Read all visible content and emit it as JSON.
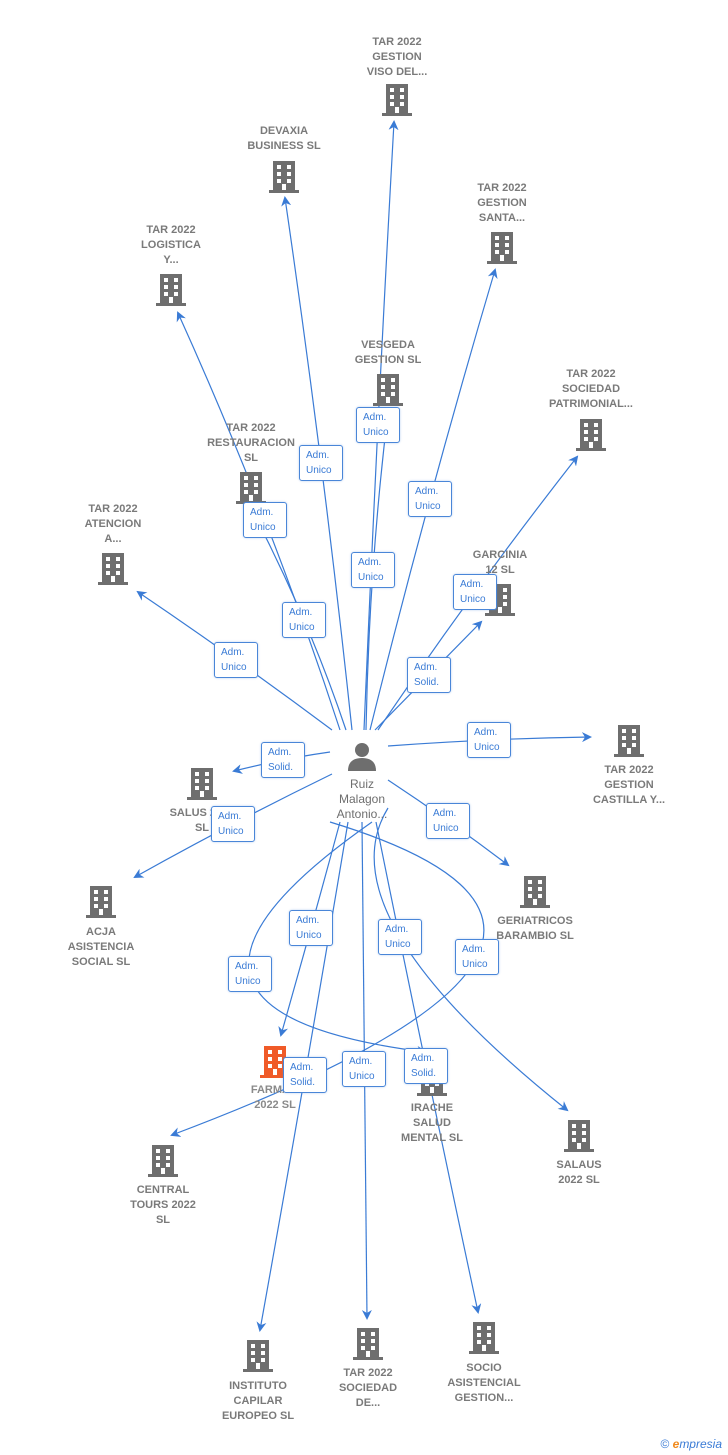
{
  "center": {
    "label_lines": [
      "Ruiz",
      "Malagon",
      "Antonio..."
    ],
    "icon": "person-icon"
  },
  "colors": {
    "edge": "#3a7bd5",
    "company": "#6e6e6e",
    "highlight": "#f05a28"
  },
  "companies": [
    {
      "lines": [
        "TAR 2022",
        "GESTION",
        "VISO DEL..."
      ]
    },
    {
      "lines": [
        "DEVAXIA",
        "BUSINESS  SL"
      ]
    },
    {
      "lines": [
        "TAR 2022",
        "GESTION",
        "SANTA..."
      ]
    },
    {
      "lines": [
        "TAR 2022",
        "LOGISTICA",
        "Y..."
      ]
    },
    {
      "lines": [
        "VESGEDA",
        "GESTION  SL"
      ]
    },
    {
      "lines": [
        "TAR 2022",
        "SOCIEDAD",
        "PATRIMONIAL..."
      ]
    },
    {
      "lines": [
        "TAR 2022",
        "RESTAURACION",
        "SL"
      ]
    },
    {
      "lines": [
        "TAR 2022",
        "ATENCION",
        "A..."
      ]
    },
    {
      "lines": [
        "GARCINIA",
        "12  SL"
      ]
    },
    {
      "lines": [
        "TAR 2022",
        "GESTION",
        "CASTILLA Y..."
      ]
    },
    {
      "lines": [
        "SALUS 2022",
        "SL"
      ]
    },
    {
      "lines": [
        "ACJA",
        "ASISTENCIA",
        "SOCIAL  SL"
      ]
    },
    {
      "lines": [
        "GERIATRICOS",
        "BARAMBIO  SL"
      ]
    },
    {
      "lines": [
        "FARMA...",
        "2022  SL"
      ],
      "highlight": true
    },
    {
      "lines": [
        "IRACHE",
        "SALUD",
        "MENTAL  SL"
      ]
    },
    {
      "lines": [
        "SALAUS",
        "2022  SL"
      ]
    },
    {
      "lines": [
        "CENTRAL",
        "TOURS 2022",
        "SL"
      ]
    },
    {
      "lines": [
        "INSTITUTO",
        "CAPILAR",
        "EUROPEO  SL"
      ]
    },
    {
      "lines": [
        "TAR 2022",
        "SOCIEDAD",
        "DE..."
      ]
    },
    {
      "lines": [
        "SOCIO",
        "ASISTENCIAL",
        "GESTION..."
      ]
    }
  ],
  "relations": [
    {
      "target": 0,
      "lines": [
        "Adm.",
        "Unico"
      ]
    },
    {
      "target": 1,
      "lines": [
        "Adm.",
        "Unico"
      ]
    },
    {
      "target": 2,
      "lines": [
        "Adm.",
        "Unico"
      ]
    },
    {
      "target": 3,
      "lines": [
        "Adm.",
        "Unico"
      ]
    },
    {
      "target": 4,
      "lines": [
        "Adm.",
        "Unico"
      ]
    },
    {
      "target": 5,
      "lines": [
        "Adm.",
        "Unico"
      ]
    },
    {
      "target": 6,
      "lines": [
        "Adm.",
        "Unico"
      ]
    },
    {
      "target": 7,
      "lines": [
        "Adm.",
        "Unico"
      ]
    },
    {
      "target": 8,
      "lines": [
        "Adm.",
        "Solid."
      ]
    },
    {
      "target": 9,
      "lines": [
        "Adm.",
        "Unico"
      ]
    },
    {
      "target": 10,
      "lines": [
        "Adm.",
        "Solid."
      ]
    },
    {
      "target": 11,
      "lines": [
        "Adm.",
        "Unico"
      ]
    },
    {
      "target": 12,
      "lines": [
        "Adm.",
        "Unico"
      ]
    },
    {
      "target": 13,
      "lines": [
        "Adm.",
        "Unico"
      ]
    },
    {
      "target": 16,
      "lines": [
        "Adm.",
        "Unico"
      ]
    },
    {
      "target": 14,
      "lines": [
        "Adm.",
        "Unico"
      ]
    },
    {
      "target": 15,
      "lines": [
        "Adm.",
        "Unico"
      ]
    },
    {
      "target": 17,
      "lines": [
        "Adm.",
        "Solid."
      ]
    },
    {
      "target": 18,
      "lines": [
        "Adm.",
        "Unico"
      ]
    },
    {
      "target": 19,
      "lines": [
        "Adm.",
        "Solid."
      ]
    }
  ],
  "footer": {
    "copyright": "©",
    "brand_first": "e",
    "brand_rest": "mpresia"
  }
}
